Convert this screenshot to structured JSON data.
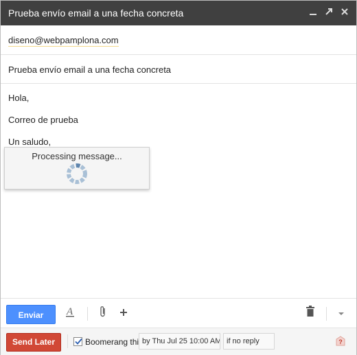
{
  "window": {
    "title": "Prueba envío email a una fecha concreta",
    "minimize_icon": "minimize-icon",
    "popout_icon": "popout-icon",
    "close_icon": "close-icon"
  },
  "compose": {
    "to_value": "diseno@webpamplona.com",
    "subject_value": "Prueba envío email a una fecha concreta",
    "body_lines": [
      "Hola,",
      "Correo de prueba",
      "Un saludo,"
    ]
  },
  "overlay": {
    "processing_text": "Processing message..."
  },
  "toolbar": {
    "send_label": "Enviar",
    "format_icon": "formatting-icon",
    "attach_icon": "paperclip-icon",
    "more_icon": "plus-icon",
    "discard_icon": "trash-icon",
    "options_icon": "chevron-down-icon"
  },
  "boomerang": {
    "send_later_label": "Send Later",
    "checkbox_checked": true,
    "boomerang_label": "Boomerang this",
    "date_value": "by Thu Jul 25 10:00 AM",
    "condition_value": "if no reply",
    "help_icon": "help-icon"
  },
  "colors": {
    "title_bar": "#404040",
    "send_button": "#4d90fe",
    "send_later_button": "#d14836"
  }
}
